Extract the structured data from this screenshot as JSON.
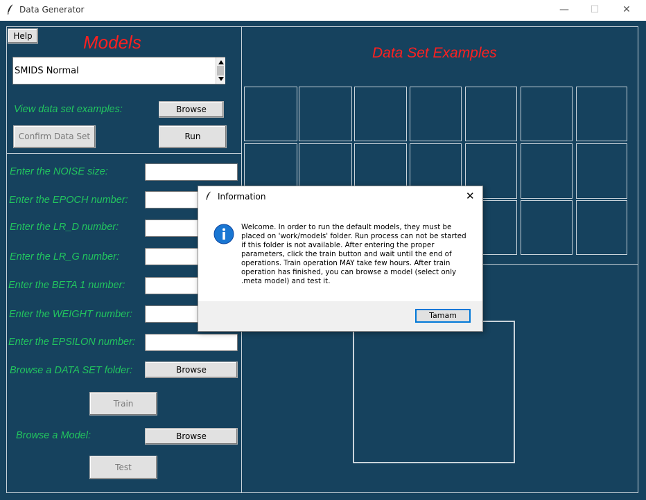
{
  "window": {
    "title": "Data Generator",
    "controls": {
      "minimize": "—",
      "maximize": "☐",
      "close": "✕"
    }
  },
  "left": {
    "help_label": "Help",
    "models_title": "Models",
    "model_list": {
      "selected": "SMIDS Normal"
    },
    "view_examples_label": "View data set examples:",
    "browse_label": "Browse",
    "confirm_label": "Confirm Data Set",
    "run_label": "Run",
    "params": [
      {
        "label": "Enter the NOISE size:"
      },
      {
        "label": "Enter the EPOCH number:"
      },
      {
        "label": "Enter the LR_D number:"
      },
      {
        "label": "Enter the LR_G number:"
      },
      {
        "label": "Enter the BETA 1 number:"
      },
      {
        "label": "Enter the WEIGHT number:"
      },
      {
        "label": "Enter the EPSILON number:"
      }
    ],
    "dataset_folder_label": "Browse a DATA SET folder:",
    "dataset_browse_label": "Browse",
    "train_label": "Train",
    "model_label": "Browse a Model:",
    "model_browse_label": "Browse",
    "test_label": "Test"
  },
  "right": {
    "examples_title": "Data Set Examples"
  },
  "dialog": {
    "title": "Information",
    "message": "Welcome. In order to run the default models, they must be placed on 'work/models' folder. Run process can not be started if this folder is not available. After entering the proper parameters, click the train button and wait until the end of operations. Train operation MAY take few hours. After train operation has finished, you can browse a model (select only .meta model) and test it.",
    "ok_label": "Tamam",
    "close_symbol": "✕"
  },
  "colors": {
    "background": "#16425e",
    "label_green": "#22c55e",
    "title_red": "#ff2020"
  },
  "icons": [
    "feather-icon",
    "info-icon",
    "close-icon",
    "minimize-icon",
    "maximize-icon"
  ]
}
